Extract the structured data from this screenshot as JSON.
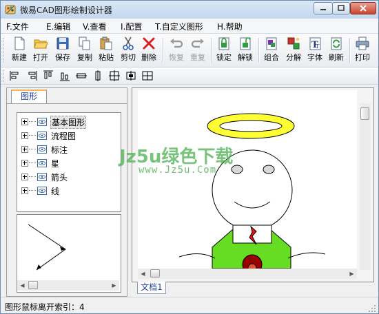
{
  "window": {
    "title": "微易CAD图形绘制设计器"
  },
  "menu": [
    "F.文件",
    "E.编辑",
    "V.查看",
    "I.配置",
    "T.自定义图形",
    "H.帮助"
  ],
  "toolbar": {
    "new": "新建",
    "open": "打开",
    "save": "保存",
    "copy": "复制",
    "paste": "粘贴",
    "cut": "剪切",
    "delete": "删除",
    "undo": "恢复",
    "redo": "重复",
    "lock": "锁定",
    "unlock": "解锁",
    "group": "组合",
    "ungroup": "分解",
    "font": "字体",
    "refresh": "刷新",
    "print": "打印"
  },
  "left_panel": {
    "tab": "图形",
    "tree": [
      "基本图形",
      "流程图",
      "标注",
      "星",
      "箭头",
      "线"
    ]
  },
  "document": {
    "tab": "文档1"
  },
  "watermark": {
    "line1": "Jz5u绿色下载",
    "line2": "www.Jz5u.Com"
  },
  "status": {
    "text": "图形鼠标离开索引：4"
  },
  "colors": {
    "title_bar": "#c8dbf0",
    "halo": "#ffff33",
    "shirt": "#66dd22",
    "tie": "#ee1111",
    "accent_tab": "#f5b24f"
  }
}
